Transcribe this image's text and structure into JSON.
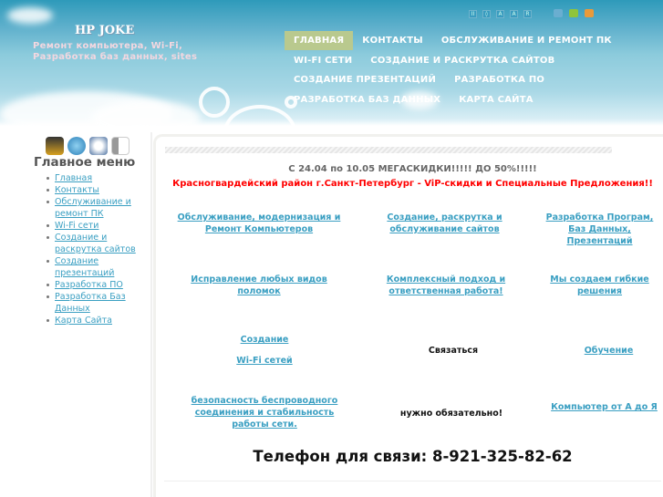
{
  "header": {
    "logo_title": "HP JOKE",
    "logo_subtitle_1": "Ремонт компьютера, Wi-Fi,",
    "logo_subtitle_2": "Разработка баз данных, sites",
    "tools": [
      "II",
      "◊",
      "A",
      "A",
      "R"
    ],
    "swatches": [
      "#6aaed0",
      "#8fc43a",
      "#e99a3a"
    ]
  },
  "nav": {
    "rows": [
      [
        "ГЛАВНАЯ",
        "КОНТАКТЫ",
        "ОБСЛУЖИВАНИЕ И РЕМОНТ ПК"
      ],
      [
        "WI-FI СЕТИ",
        "СОЗДАНИЕ И РАСКРУТКА САЙТОВ"
      ],
      [
        "СОЗДАНИЕ ПРЕЗЕНТАЦИЙ",
        "РАЗРАБОТКА ПО"
      ],
      [
        "РАЗРАБОТКА БАЗ ДАННЫХ",
        "КАРТА САЙТА"
      ]
    ],
    "active": "ГЛАВНАЯ"
  },
  "sidebar": {
    "title": "Главное меню",
    "items": [
      "Главная",
      "Контакты",
      "Обслуживание и ремонт ПК",
      "Wi-Fi сети",
      "Создание и раскрутка сайтов",
      "Создание презентаций",
      "Разработка ПО",
      "Разработка Баз Данных",
      "Карта Сайта"
    ]
  },
  "main": {
    "promo": "С 24.04 по 10.05 МЕГАСКИДКИ!!!!! ДО 50%!!!!!",
    "promo_red": "Красногвардейский район г.Санкт-Петербург - ViP-скидки и Специальные Предложения!!",
    "cells": {
      "c1": "Обслуживание, модернизация и Ремонт Компьютеров",
      "c2": "Создание, раскрутка и обслуживание сайтов",
      "c3": "Разработка Програм, Баз Данных, Презентаций",
      "c4": "Исправление любых видов поломок",
      "c5": "Комплексный подход и ответственная работа!",
      "c6": "Мы создаем гибкие решения",
      "c7a": "Создание",
      "c7b": "Wi-Fi сетей",
      "c8": "Связаться",
      "c9": "Обучение",
      "c10": "безопасность беспроводного соединения и стабильность работы сети.",
      "c11": "нужно обязательно!",
      "c12": "Компьютер от А до Я"
    },
    "phone": "Телефон для связи: 8-921-325-82-62"
  },
  "colors": {
    "accent": "#3a9fc2",
    "red": "#ff0000",
    "nav_active": "#b9c98e"
  }
}
